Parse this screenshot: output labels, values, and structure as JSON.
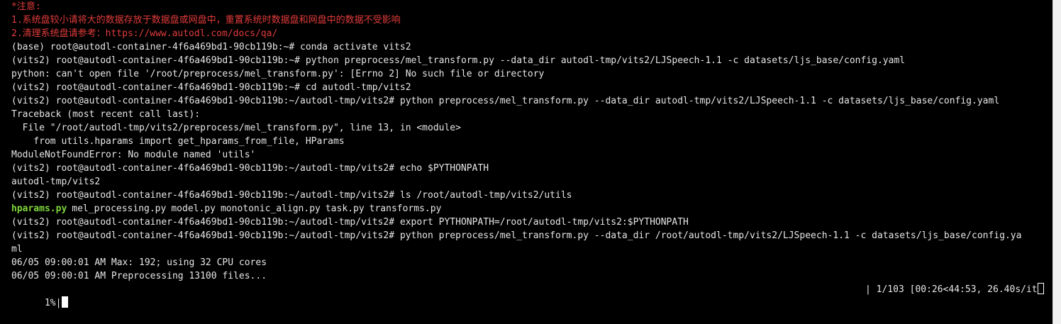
{
  "notice": {
    "title": "*注意:",
    "line1": "1.系统盘较小请将大的数据存放于数据盘或网盘中，重置系统时数据盘和网盘中的数据不受影响",
    "line2": "2.清理系统盘请参考：https://www.autodl.com/docs/qa/"
  },
  "session": [
    "(base) root@autodl-container-4f6a469bd1-90cb119b:~# conda activate vits2",
    "(vits2) root@autodl-container-4f6a469bd1-90cb119b:~# python preprocess/mel_transform.py --data_dir autodl-tmp/vits2/LJSpeech-1.1 -c datasets/ljs_base/config.yaml",
    "python: can't open file '/root/preprocess/mel_transform.py': [Errno 2] No such file or directory",
    "(vits2) root@autodl-container-4f6a469bd1-90cb119b:~# cd autodl-tmp/vits2",
    "(vits2) root@autodl-container-4f6a469bd1-90cb119b:~/autodl-tmp/vits2# python preprocess/mel_transform.py --data_dir autodl-tmp/vits2/LJSpeech-1.1 -c datasets/ljs_base/config.yaml",
    "Traceback (most recent call last):",
    "  File \"/root/autodl-tmp/vits2/preprocess/mel_transform.py\", line 13, in <module>",
    "    from utils.hparams import get_hparams_from_file, HParams",
    "ModuleNotFoundError: No module named 'utils'",
    "(vits2) root@autodl-container-4f6a469bd1-90cb119b:~/autodl-tmp/vits2# echo $PYTHONPATH",
    "autodl-tmp/vits2",
    "(vits2) root@autodl-container-4f6a469bd1-90cb119b:~/autodl-tmp/vits2# ls /root/autodl-tmp/vits2/utils"
  ],
  "ls_output": {
    "highlighted": "hparams.py",
    "others": [
      "mel_processing.py",
      "model.py",
      "monotonic_align.py",
      "task.py",
      "transforms.py"
    ]
  },
  "session2": [
    "(vits2) root@autodl-container-4f6a469bd1-90cb119b:~/autodl-tmp/vits2# export PYTHONPATH=/root/autodl-tmp/vits2:$PYTHONPATH",
    "(vits2) root@autodl-container-4f6a469bd1-90cb119b:~/autodl-tmp/vits2# python preprocess/mel_transform.py --data_dir /root/autodl-tmp/vits2/LJSpeech-1.1 -c datasets/ljs_base/config.ya",
    "ml",
    "06/05 09:00:01 AM Max: 192; using 32 CPU cores",
    "06/05 09:00:01 AM Preprocessing 13100 files..."
  ],
  "progress": {
    "percent_text": "  1%|",
    "stats_text": "| 1/103 [00:26<44:53, 26.40s/it",
    "fraction": 0.0097
  },
  "colors": {
    "background": "#000000",
    "foreground": "#e6e6e6",
    "notice": "#e23b3b",
    "executable": "#7fd63c"
  }
}
